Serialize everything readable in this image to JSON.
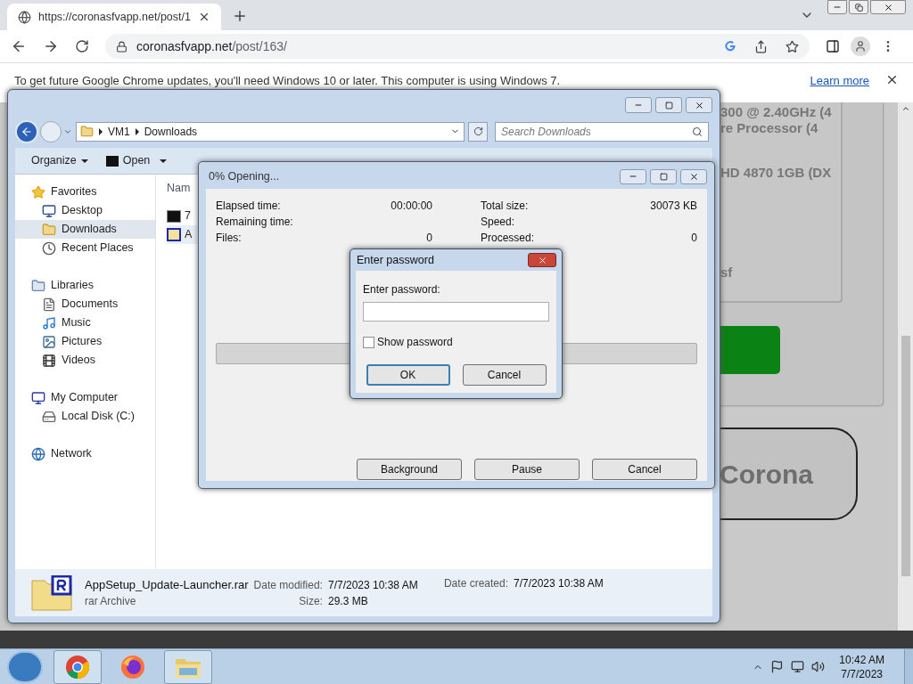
{
  "browser": {
    "tab": {
      "title": "https://coronasfvapp.net/post/1"
    },
    "address": {
      "domain": "coronasfvapp.net",
      "path": "/post/163/"
    },
    "infobar": {
      "message": "To get future Google Chrome updates, you'll need Windows 10 or later. This computer is using Windows 7.",
      "link": "Learn more"
    }
  },
  "webpage": {
    "lines": [
      "300 @ 2.40GHz (4",
      "re Processor (4",
      "HD 4870 1GB (DX",
      "sf"
    ],
    "button": "Corona"
  },
  "explorer": {
    "breadcrumb": [
      "VM1",
      "Downloads"
    ],
    "search": {
      "placeholder": "Search Downloads"
    },
    "toolbar": [
      "Organize",
      "Open"
    ],
    "nav": [
      {
        "label": "Favorites",
        "kind": "star",
        "selected": false,
        "children": [
          {
            "label": "Desktop",
            "kind": "desktop",
            "selected": false
          },
          {
            "label": "Downloads",
            "kind": "downloads",
            "selected": true
          },
          {
            "label": "Recent Places",
            "kind": "recent",
            "selected": false
          }
        ]
      },
      {
        "label": "Libraries",
        "kind": "libraries",
        "selected": false,
        "children": [
          {
            "label": "Documents",
            "kind": "documents",
            "selected": false
          },
          {
            "label": "Music",
            "kind": "music",
            "selected": false
          },
          {
            "label": "Pictures",
            "kind": "pictures",
            "selected": false
          },
          {
            "label": "Videos",
            "kind": "videos",
            "selected": false
          }
        ]
      },
      {
        "label": "My Computer",
        "kind": "computer",
        "selected": false,
        "children": [
          {
            "label": "Local Disk (C:)",
            "kind": "disk",
            "selected": false
          }
        ]
      },
      {
        "label": "Network",
        "kind": "network",
        "selected": false
      }
    ],
    "column": "Nam",
    "files": [
      {
        "name": "7",
        "kind": "sevenzip",
        "selected": false
      },
      {
        "name": "A",
        "kind": "rar",
        "selected": true
      }
    ],
    "details": {
      "name": "AppSetup_Update-Launcher.rar",
      "type": "rar Archive",
      "fields": [
        {
          "label": "Date modified:",
          "value": "7/7/2023 10:38 AM"
        },
        {
          "label": "Size:",
          "value": "29.3 MB"
        },
        {
          "label": "Date created:",
          "value": "7/7/2023 10:38 AM"
        }
      ]
    }
  },
  "progress": {
    "title": "0% Opening...",
    "left": [
      {
        "label": "Elapsed time:",
        "value": "00:00:00"
      },
      {
        "label": "Remaining time:"
      },
      {
        "label": "Files:",
        "value": "0"
      }
    ],
    "right": [
      {
        "label": "Total size:",
        "value": "30073 KB"
      },
      {
        "label": "Speed:"
      },
      {
        "label": "Processed:",
        "value": "0"
      }
    ],
    "level": 0,
    "buttons": [
      "Background",
      "Pause",
      "Cancel"
    ]
  },
  "password": {
    "title": "Enter password",
    "label": "Enter password:",
    "show_password": {
      "label": "Show password",
      "checked": false
    },
    "buttons": [
      "OK",
      "Cancel"
    ]
  },
  "taskbar": {
    "apps": [
      {
        "kind": "chrome",
        "selected": true
      },
      {
        "kind": "firefox",
        "selected": false
      },
      {
        "kind": "explorer",
        "selected": true
      }
    ],
    "time": "10:42 AM",
    "date": "7/7/2023"
  }
}
